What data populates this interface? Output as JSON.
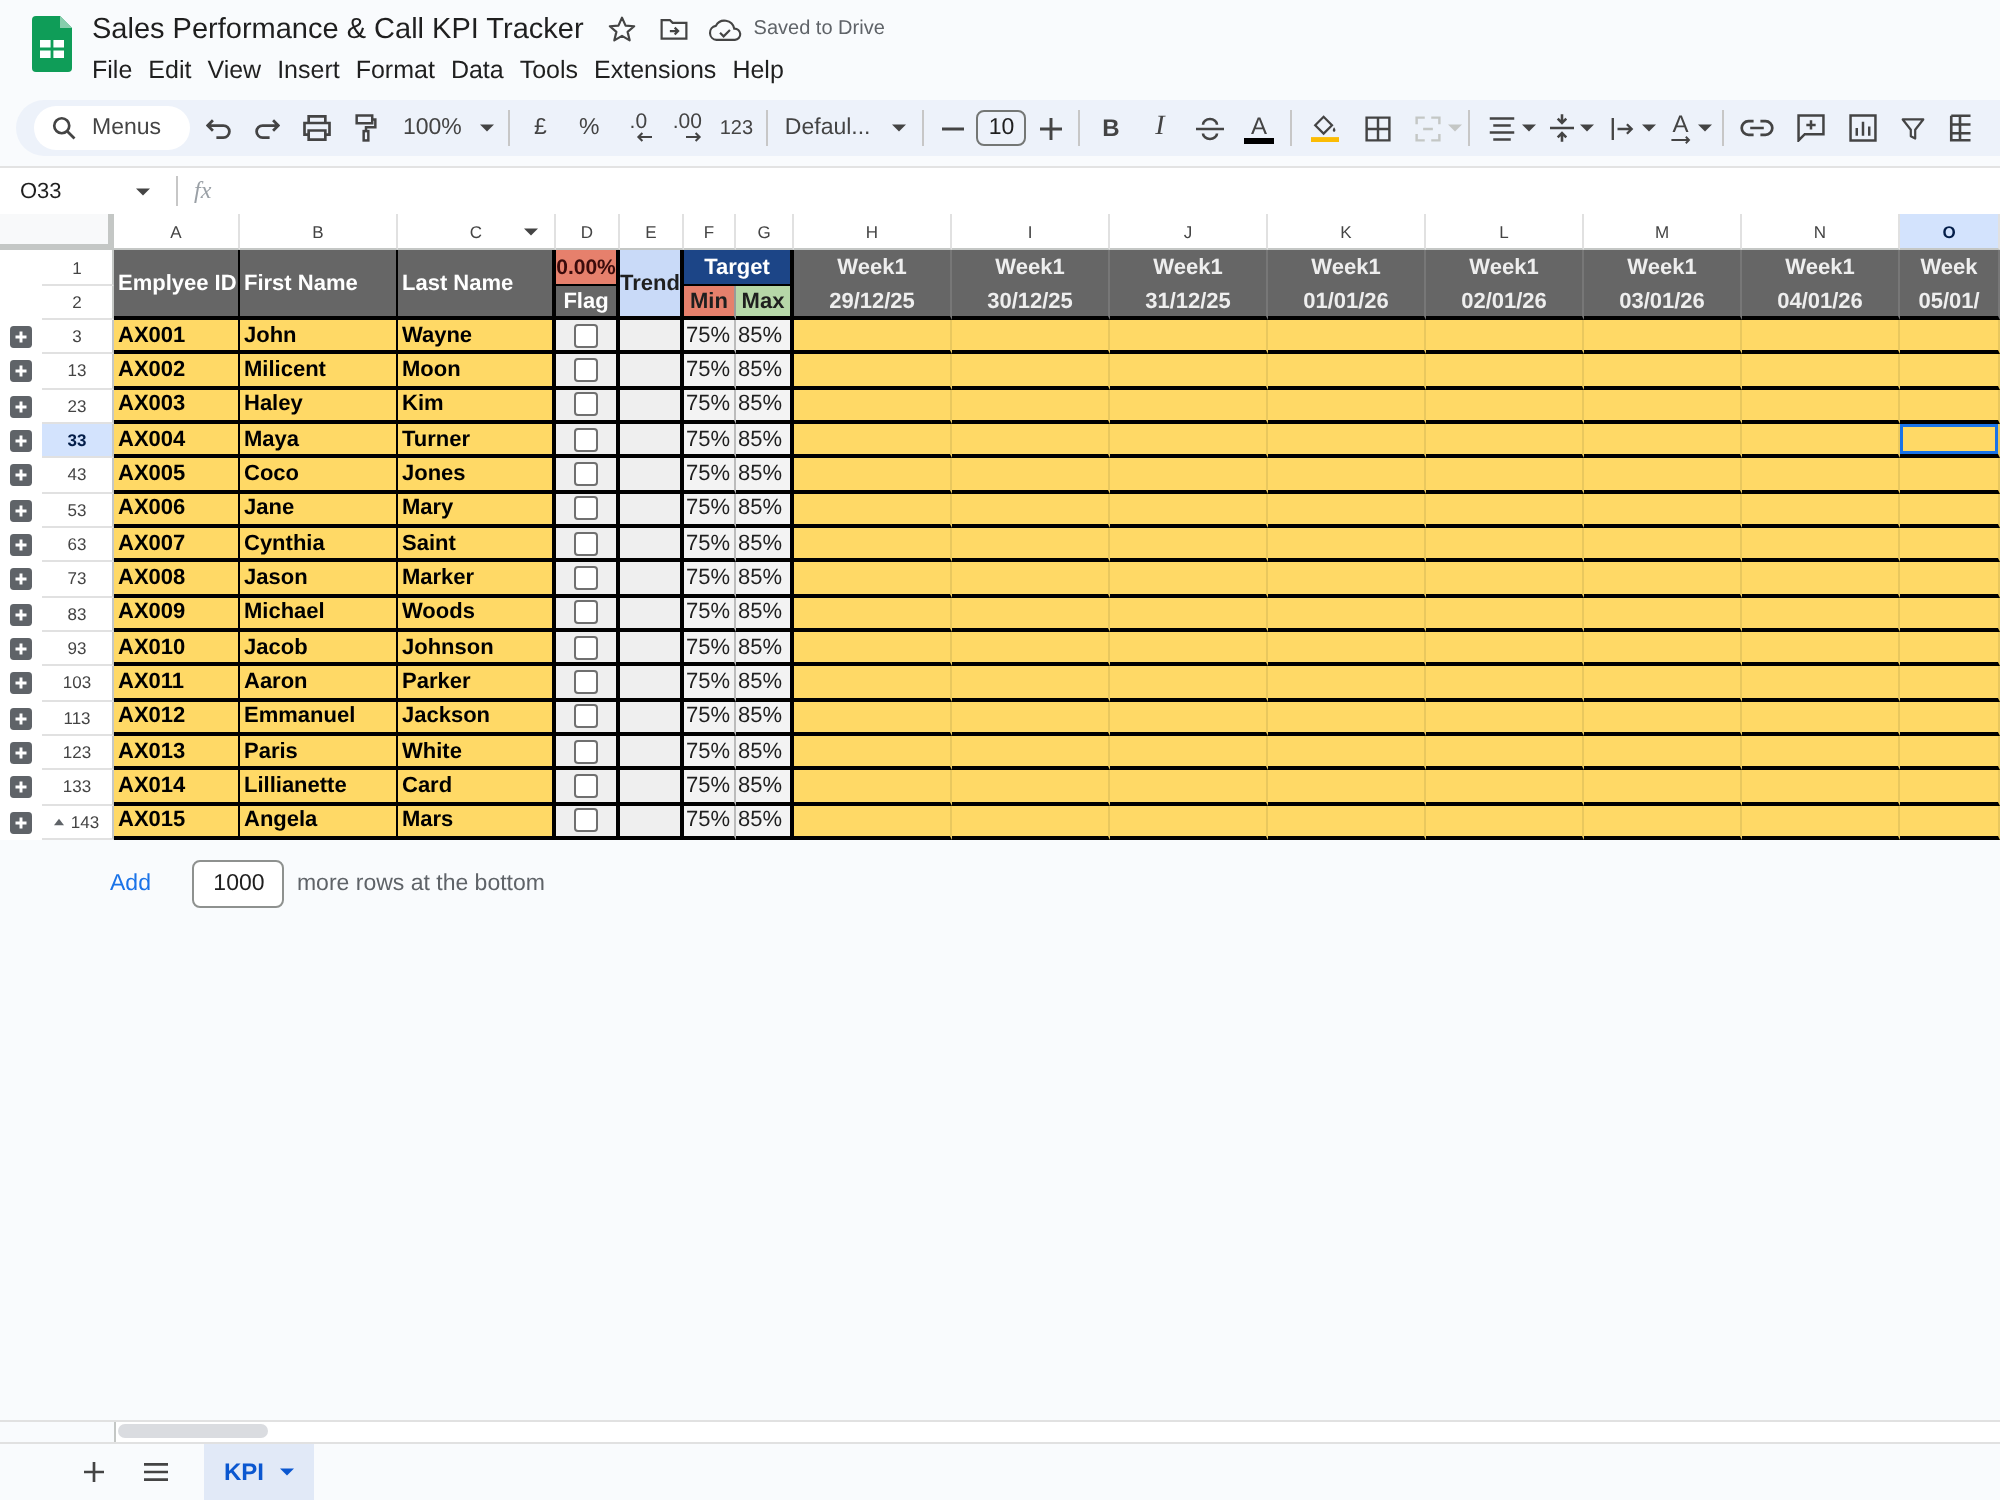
{
  "app": {
    "title": "Sales Performance & Call KPI Tracker",
    "save_status": "Saved to Drive"
  },
  "menu_bar": [
    "File",
    "Edit",
    "View",
    "Insert",
    "Format",
    "Data",
    "Tools",
    "Extensions",
    "Help"
  ],
  "toolbar": {
    "search_placeholder": "Menus",
    "zoom": "100%",
    "currency": "£",
    "percent": "%",
    "decrease_decimal": ".0",
    "increase_decimal": ".00",
    "number_format": "123",
    "font": "Defaul...",
    "font_size": "10",
    "bold": "B",
    "italic": "I",
    "text_color": "A",
    "merge_disabled": true,
    "text_rotation": "A"
  },
  "formula_bar": {
    "cell_ref": "O33",
    "fx": "fx"
  },
  "sheet": {
    "columns": [
      {
        "label": "A",
        "selected": false,
        "hovered": false
      },
      {
        "label": "B",
        "selected": false,
        "hovered": false
      },
      {
        "label": "C",
        "selected": false,
        "hovered": true
      },
      {
        "label": "D",
        "selected": false,
        "hovered": false
      },
      {
        "label": "E",
        "selected": false,
        "hovered": false
      },
      {
        "label": "F",
        "selected": false,
        "hovered": false
      },
      {
        "label": "G",
        "selected": false,
        "hovered": false
      },
      {
        "label": "H",
        "selected": false,
        "hovered": false
      },
      {
        "label": "I",
        "selected": false,
        "hovered": false
      },
      {
        "label": "J",
        "selected": false,
        "hovered": false
      },
      {
        "label": "K",
        "selected": false,
        "hovered": false
      },
      {
        "label": "L",
        "selected": false,
        "hovered": false
      },
      {
        "label": "M",
        "selected": false,
        "hovered": false
      },
      {
        "label": "N",
        "selected": false,
        "hovered": false
      },
      {
        "label": "O",
        "selected": true,
        "hovered": false
      }
    ],
    "header_rows": [
      {
        "number": "1",
        "selected": false
      },
      {
        "number": "2",
        "selected": false
      }
    ],
    "header": {
      "employee_id": "Emplyee ID",
      "first_name": "First Name",
      "last_name": "Last Name",
      "flag_percent": "0.00%",
      "flag": "Flag",
      "trend": "Trend",
      "target": "Target",
      "min": "Min",
      "max": "Max"
    },
    "weeks": [
      {
        "week": "Week1",
        "date": "29/12/25"
      },
      {
        "week": "Week1",
        "date": "30/12/25"
      },
      {
        "week": "Week1",
        "date": "31/12/25"
      },
      {
        "week": "Week1",
        "date": "01/01/26"
      },
      {
        "week": "Week1",
        "date": "02/01/26"
      },
      {
        "week": "Week1",
        "date": "03/01/26"
      },
      {
        "week": "Week1",
        "date": "04/01/26"
      },
      {
        "week": "Week",
        "date": "05/01/"
      }
    ],
    "rows": [
      {
        "number": "3",
        "selected": false,
        "group_expanded": false,
        "group_marker": false,
        "employee_id": "AX001",
        "first_name": "John",
        "last_name": "Wayne",
        "flagged": false,
        "min": "75%",
        "max": "85%"
      },
      {
        "number": "13",
        "selected": false,
        "group_expanded": false,
        "group_marker": false,
        "employee_id": "AX002",
        "first_name": "Milicent",
        "last_name": "Moon",
        "flagged": false,
        "min": "75%",
        "max": "85%"
      },
      {
        "number": "23",
        "selected": false,
        "group_expanded": false,
        "group_marker": false,
        "employee_id": "AX003",
        "first_name": "Haley",
        "last_name": "Kim",
        "flagged": false,
        "min": "75%",
        "max": "85%"
      },
      {
        "number": "33",
        "selected": true,
        "group_expanded": false,
        "group_marker": false,
        "employee_id": "AX004",
        "first_name": "Maya",
        "last_name": "Turner",
        "flagged": false,
        "min": "75%",
        "max": "85%"
      },
      {
        "number": "43",
        "selected": false,
        "group_expanded": false,
        "group_marker": false,
        "employee_id": "AX005",
        "first_name": "Coco",
        "last_name": "Jones",
        "flagged": false,
        "min": "75%",
        "max": "85%"
      },
      {
        "number": "53",
        "selected": false,
        "group_expanded": false,
        "group_marker": false,
        "employee_id": "AX006",
        "first_name": "Jane",
        "last_name": "Mary",
        "flagged": false,
        "min": "75%",
        "max": "85%"
      },
      {
        "number": "63",
        "selected": false,
        "group_expanded": false,
        "group_marker": false,
        "employee_id": "AX007",
        "first_name": "Cynthia",
        "last_name": "Saint",
        "flagged": false,
        "min": "75%",
        "max": "85%"
      },
      {
        "number": "73",
        "selected": false,
        "group_expanded": false,
        "group_marker": false,
        "employee_id": "AX008",
        "first_name": "Jason",
        "last_name": "Marker",
        "flagged": false,
        "min": "75%",
        "max": "85%"
      },
      {
        "number": "83",
        "selected": false,
        "group_expanded": false,
        "group_marker": false,
        "employee_id": "AX009",
        "first_name": "Michael",
        "last_name": "Woods",
        "flagged": false,
        "min": "75%",
        "max": "85%"
      },
      {
        "number": "93",
        "selected": false,
        "group_expanded": false,
        "group_marker": false,
        "employee_id": "AX010",
        "first_name": "Jacob",
        "last_name": "Johnson",
        "flagged": false,
        "min": "75%",
        "max": "85%"
      },
      {
        "number": "103",
        "selected": false,
        "group_expanded": false,
        "group_marker": false,
        "employee_id": "AX011",
        "first_name": "Aaron",
        "last_name": "Parker",
        "flagged": false,
        "min": "75%",
        "max": "85%"
      },
      {
        "number": "113",
        "selected": false,
        "group_expanded": false,
        "group_marker": false,
        "employee_id": "AX012",
        "first_name": "Emmanuel",
        "last_name": "Jackson",
        "flagged": false,
        "min": "75%",
        "max": "85%"
      },
      {
        "number": "123",
        "selected": false,
        "group_expanded": false,
        "group_marker": false,
        "employee_id": "AX013",
        "first_name": "Paris",
        "last_name": "White",
        "flagged": false,
        "min": "75%",
        "max": "85%"
      },
      {
        "number": "133",
        "selected": false,
        "group_expanded": false,
        "group_marker": false,
        "employee_id": "AX014",
        "first_name": "Lillianette",
        "last_name": "Card",
        "flagged": false,
        "min": "75%",
        "max": "85%"
      },
      {
        "number": "143",
        "selected": false,
        "group_expanded": false,
        "group_marker": true,
        "employee_id": "AX015",
        "first_name": "Angela",
        "last_name": "Mars",
        "flagged": false,
        "min": "75%",
        "max": "85%"
      }
    ]
  },
  "add_rows": {
    "link": "Add",
    "count": "1000",
    "text": "more rows at the bottom"
  },
  "sheet_tabs": [
    {
      "label": "KPI",
      "selected": true
    }
  ]
}
